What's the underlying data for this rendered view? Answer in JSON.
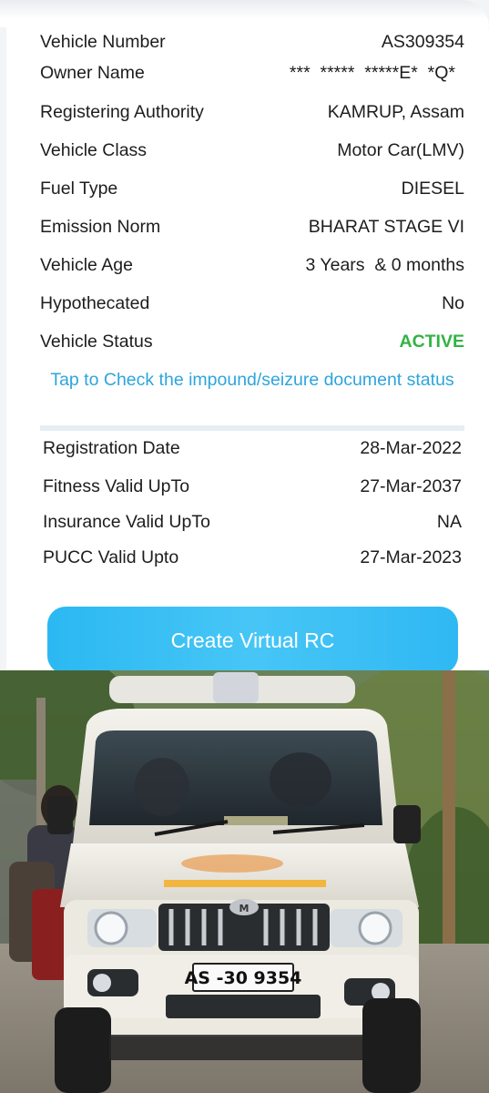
{
  "details": [
    {
      "label": "Vehicle Number",
      "value": "AS309354"
    },
    {
      "label": "Owner Name",
      "value": "***  *****  *****E*  *Q*"
    },
    {
      "label": "Registering Authority",
      "value": "KAMRUP, Assam"
    },
    {
      "label": "Vehicle Class",
      "value": "Motor Car(LMV)"
    },
    {
      "label": "Fuel Type",
      "value": "DIESEL"
    },
    {
      "label": "Emission Norm",
      "value": "BHARAT STAGE VI"
    },
    {
      "label": "Vehicle Age",
      "value": "3 Years  & 0 months"
    },
    {
      "label": "Hypothecated",
      "value": "No"
    },
    {
      "label": "Vehicle Status",
      "value": "ACTIVE"
    }
  ],
  "impound_link": "Tap to Check the impound/seizure document status",
  "validity": [
    {
      "label": "Registration Date",
      "value": "28-Mar-2022"
    },
    {
      "label": "Fitness Valid UpTo",
      "value": "27-Mar-2037"
    },
    {
      "label": "Insurance Valid UpTo",
      "value": "NA"
    },
    {
      "label": "PUCC Valid Upto",
      "value": "27-Mar-2023"
    }
  ],
  "create_button_label": "Create Virtual RC",
  "photo": {
    "plate_text": "AS -30 9354",
    "grille_logo": "M"
  },
  "colors": {
    "active": "#32b343",
    "link": "#2da5dc",
    "button": "#2bb8f2"
  }
}
